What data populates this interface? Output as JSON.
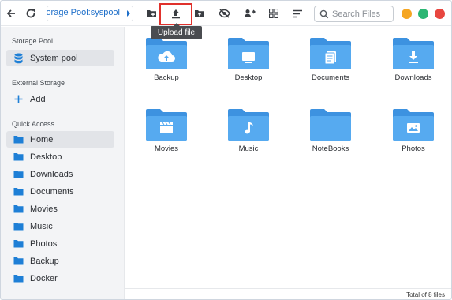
{
  "toolbar": {
    "path": "orage Pool:syspool",
    "search_placeholder": "Search Files",
    "tooltip": "Upload file",
    "window_controls": [
      {
        "name": "minimize",
        "color": "#f5a623"
      },
      {
        "name": "maximize",
        "color": "#2bb673"
      },
      {
        "name": "close",
        "color": "#e8463f"
      }
    ],
    "icons": [
      "back-icon",
      "refresh-icon",
      "new-folder-icon",
      "upload-icon",
      "upload-folder-icon",
      "hide-icon",
      "share-icon",
      "grid-view-icon",
      "sort-icon",
      "search-icon"
    ]
  },
  "sidebar": {
    "storage_pool_title": "Storage Pool",
    "storage_pool_item": "System pool",
    "external_title": "External Storage",
    "add_label": "Add",
    "quick_title": "Quick Access",
    "quick_items": [
      {
        "label": "Home"
      },
      {
        "label": "Desktop"
      },
      {
        "label": "Downloads"
      },
      {
        "label": "Documents"
      },
      {
        "label": "Movies"
      },
      {
        "label": "Music"
      },
      {
        "label": "Photos"
      },
      {
        "label": "Backup"
      },
      {
        "label": "Docker"
      }
    ]
  },
  "folders": [
    {
      "name": "Backup",
      "icon": "cloud-upload-icon"
    },
    {
      "name": "Desktop",
      "icon": "monitor-icon"
    },
    {
      "name": "Documents",
      "icon": "documents-icon"
    },
    {
      "name": "Downloads",
      "icon": "download-icon"
    },
    {
      "name": "Movies",
      "icon": "clapperboard-icon"
    },
    {
      "name": "Music",
      "icon": "music-note-icon"
    },
    {
      "name": "NoteBooks",
      "icon": "notebook-icon"
    },
    {
      "name": "Photos",
      "icon": "image-icon"
    }
  ],
  "status": {
    "text": "Total of 8 files"
  },
  "colors": {
    "folder_back": "#3d92e0",
    "folder_front": "#56aaf0",
    "accent": "#1e6fc9"
  }
}
